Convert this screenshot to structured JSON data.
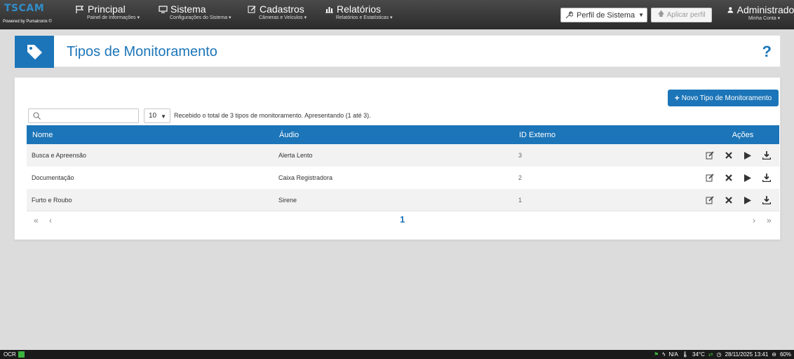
{
  "navbar": {
    "logo": {
      "text": "TSCAM",
      "powered": "Powered by Pumatronix ©"
    },
    "menus": [
      {
        "title": "Principal",
        "subtitle": "Painel de Informações ▾",
        "icon": "flag-icon"
      },
      {
        "title": "Sistema",
        "subtitle": "Configurações do Sistema ▾",
        "icon": "monitor-icon"
      },
      {
        "title": "Cadastros",
        "subtitle": "Câmeras e Veículos ▾",
        "icon": "edit-icon"
      },
      {
        "title": "Relatórios",
        "subtitle": "Relatórios e Estatísticas ▾",
        "icon": "bar-chart-icon"
      }
    ],
    "profile_select": {
      "value": "Perfil de Sistema",
      "icon": "wrench-icon"
    },
    "apply_profile_label": "Aplicar perfil",
    "account": {
      "title": "Administrador",
      "subtitle": "Minha Conta ▾",
      "icon": "user-icon"
    }
  },
  "page": {
    "title": "Tipos de Monitoramento",
    "help_label": "?",
    "icon": "tag-icon"
  },
  "toolbar": {
    "new_button_label": "Novo Tipo de Monitoramento",
    "search_placeholder": "",
    "page_size": "10",
    "summary": "Recebido o total de 3 tipos de monitoramento. Apresentando (1 até 3)."
  },
  "table": {
    "columns": [
      "Nome",
      "Áudio",
      "ID Externo",
      "Ações"
    ],
    "rows": [
      {
        "nome": "Busca e Apreensão",
        "audio": "Alerta Lento",
        "id": "3"
      },
      {
        "nome": "Documentação",
        "audio": "Caixa Registradora",
        "id": "2"
      },
      {
        "nome": "Furto e Roubo",
        "audio": "Sirene",
        "id": "1"
      }
    ]
  },
  "pagination": {
    "first": "«",
    "prev": "‹",
    "current": "1",
    "next": "›",
    "last": "»"
  },
  "statusbar": {
    "ocr_label": "OCR",
    "power": "N/A",
    "temperature": "34°C",
    "datetime": "28/11/2025 13:41",
    "disk": "60%"
  },
  "colors": {
    "primary": "#1c75b8",
    "ok": "#3db43d"
  }
}
